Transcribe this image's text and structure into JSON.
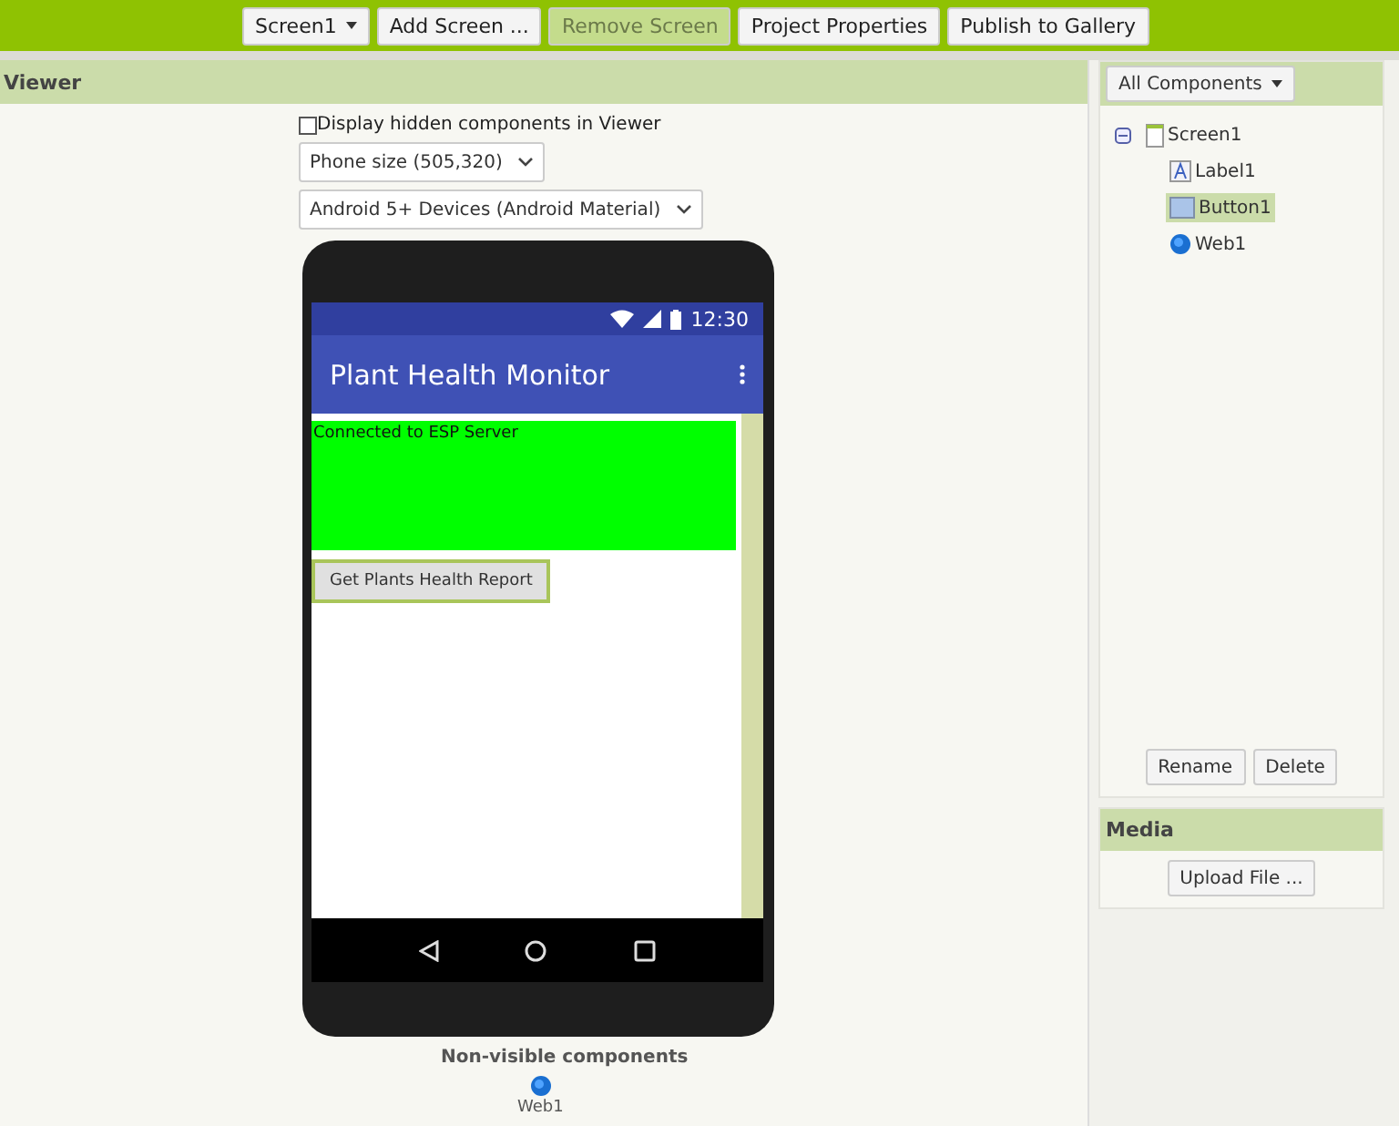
{
  "toolbar": [
    {
      "label": "Screen1",
      "kind": "dropdown",
      "disabled": false
    },
    {
      "label": "Add Screen ...",
      "kind": "button",
      "disabled": false
    },
    {
      "label": "Remove Screen",
      "kind": "button",
      "disabled": true
    },
    {
      "label": "Project Properties",
      "kind": "button",
      "disabled": false
    },
    {
      "label": "Publish to Gallery",
      "kind": "button",
      "disabled": false
    }
  ],
  "viewer": {
    "title": "Viewer",
    "hidden_checkbox": {
      "label": "Display hidden components in Viewer",
      "checked": false
    },
    "size_select": "Phone size (505,320)",
    "theme_select": "Android 5+ Devices (Android Material)",
    "phone": {
      "time": "12:30",
      "app_title": "Plant Health Monitor",
      "label_text": "Connected to ESP Server",
      "button_text": "Get Plants Health Report"
    },
    "nonvisible_title": "Non-visible components",
    "nonvisible": [
      {
        "name": "Web1"
      }
    ]
  },
  "components": {
    "filter": "All Components",
    "tree": [
      {
        "name": "Screen1",
        "kind": "screen",
        "expanded": true,
        "selected": false,
        "children": [
          {
            "name": "Label1",
            "kind": "label",
            "selected": false
          },
          {
            "name": "Button1",
            "kind": "button",
            "selected": true
          },
          {
            "name": "Web1",
            "kind": "web",
            "selected": false
          }
        ]
      }
    ],
    "buttons": [
      "Rename",
      "Delete"
    ]
  },
  "media": {
    "title": "Media",
    "button": "Upload File ..."
  }
}
